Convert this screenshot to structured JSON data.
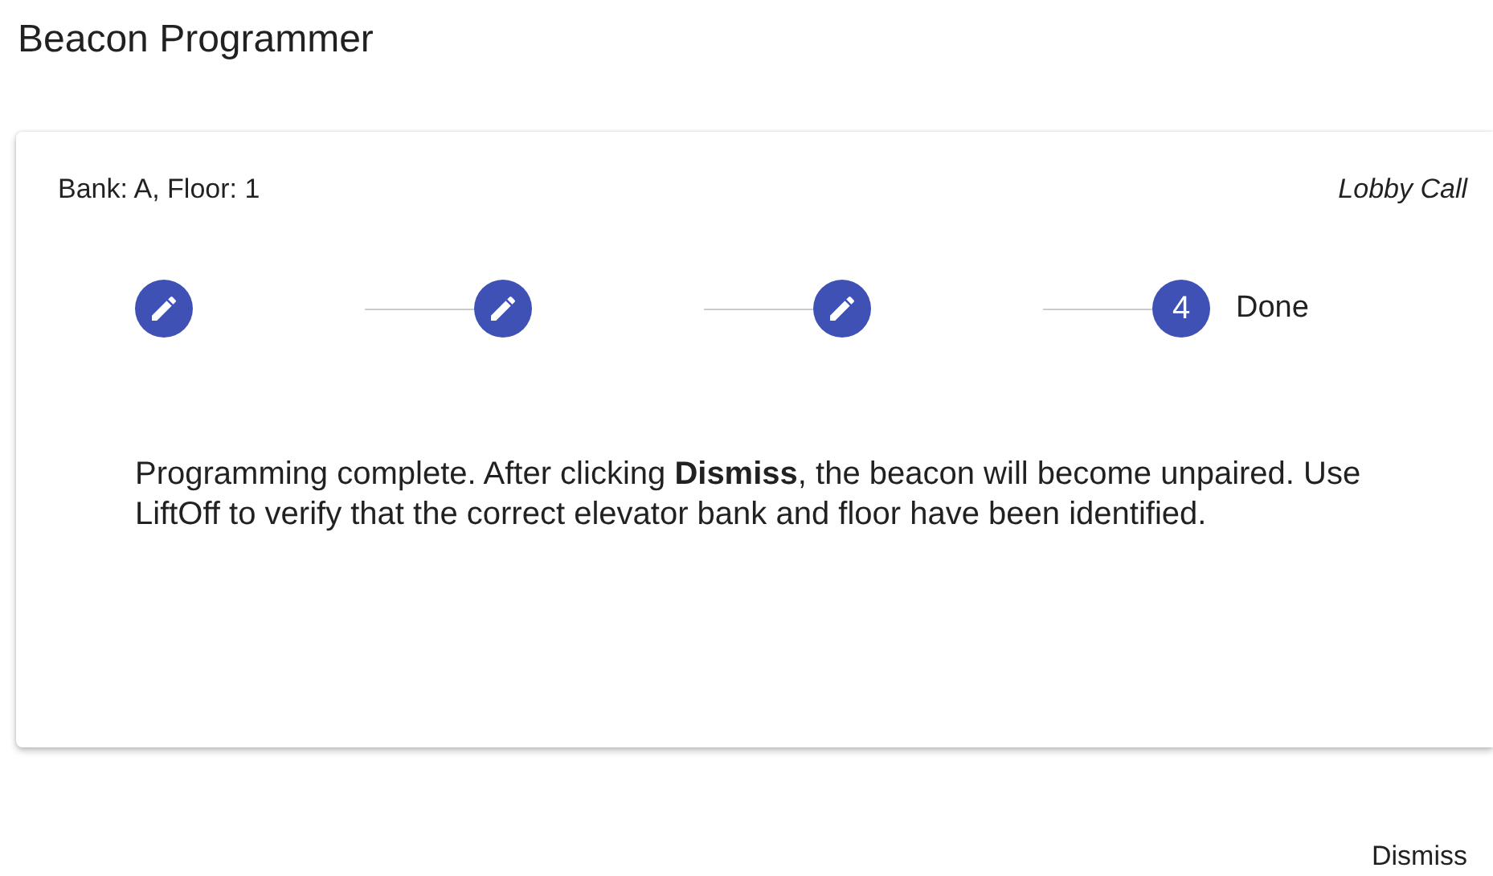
{
  "title": "Beacon Programmer",
  "card": {
    "location": "Bank: A, Floor: 1",
    "call_type": "Lobby Call",
    "steps": [
      {
        "kind": "edit"
      },
      {
        "kind": "edit"
      },
      {
        "kind": "edit"
      },
      {
        "kind": "number",
        "number": "4",
        "label": "Done"
      }
    ],
    "message": "Programming complete. After clicking **Dismiss**, the beacon will become unpaired. Use LiftOff to verify that the correct elevator bank and floor have been identified."
  },
  "buttons": [
    "Dismiss"
  ]
}
